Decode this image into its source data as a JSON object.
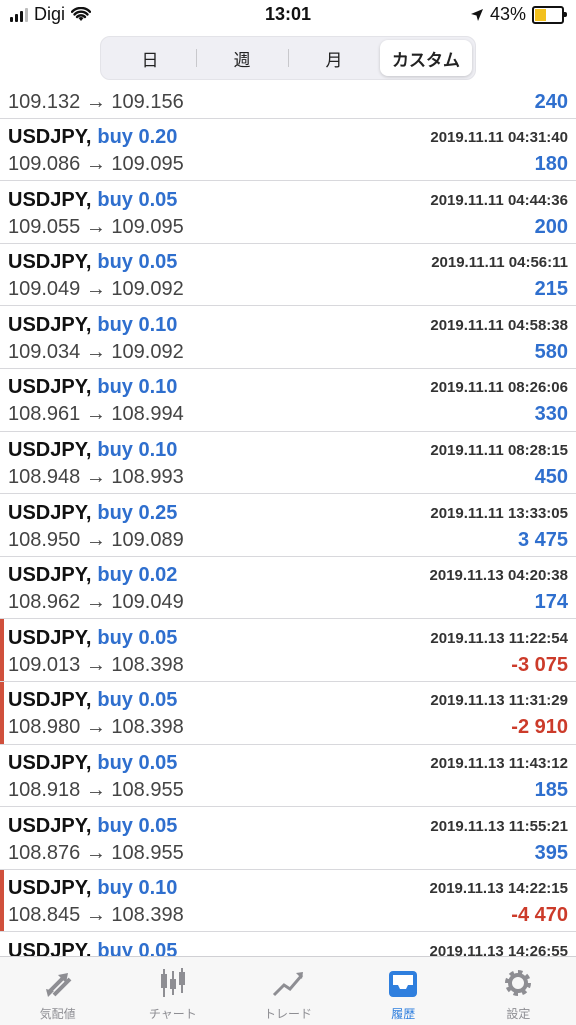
{
  "status_bar": {
    "carrier": "Digi",
    "time": "13:01",
    "battery": "43%",
    "battery_level": 0.43
  },
  "segments": [
    {
      "label": "日",
      "active": false
    },
    {
      "label": "週",
      "active": false
    },
    {
      "label": "月",
      "active": false
    },
    {
      "label": "カスタム",
      "active": true
    }
  ],
  "trades": [
    {
      "symbol": "",
      "side": "",
      "time": "",
      "prices": "109.132 → 109.156",
      "profit": "240",
      "loss": false
    },
    {
      "symbol": "USDJPY,",
      "side": "buy 0.20",
      "time": "2019.11.11 04:31:40",
      "prices": "109.086 → 109.095",
      "profit": "180",
      "loss": false
    },
    {
      "symbol": "USDJPY,",
      "side": "buy 0.05",
      "time": "2019.11.11 04:44:36",
      "prices": "109.055 → 109.095",
      "profit": "200",
      "loss": false
    },
    {
      "symbol": "USDJPY,",
      "side": "buy 0.05",
      "time": "2019.11.11 04:56:11",
      "prices": "109.049 → 109.092",
      "profit": "215",
      "loss": false
    },
    {
      "symbol": "USDJPY,",
      "side": "buy 0.10",
      "time": "2019.11.11 04:58:38",
      "prices": "109.034 → 109.092",
      "profit": "580",
      "loss": false
    },
    {
      "symbol": "USDJPY,",
      "side": "buy 0.10",
      "time": "2019.11.11 08:26:06",
      "prices": "108.961 → 108.994",
      "profit": "330",
      "loss": false
    },
    {
      "symbol": "USDJPY,",
      "side": "buy 0.10",
      "time": "2019.11.11 08:28:15",
      "prices": "108.948 → 108.993",
      "profit": "450",
      "loss": false
    },
    {
      "symbol": "USDJPY,",
      "side": "buy 0.25",
      "time": "2019.11.11 13:33:05",
      "prices": "108.950 → 109.089",
      "profit": "3 475",
      "loss": false
    },
    {
      "symbol": "USDJPY,",
      "side": "buy 0.02",
      "time": "2019.11.13 04:20:38",
      "prices": "108.962 → 109.049",
      "profit": "174",
      "loss": false
    },
    {
      "symbol": "USDJPY,",
      "side": "buy 0.05",
      "time": "2019.11.13 11:22:54",
      "prices": "109.013 → 108.398",
      "profit": "-3 075",
      "loss": true
    },
    {
      "symbol": "USDJPY,",
      "side": "buy 0.05",
      "time": "2019.11.13 11:31:29",
      "prices": "108.980 → 108.398",
      "profit": "-2 910",
      "loss": true
    },
    {
      "symbol": "USDJPY,",
      "side": "buy 0.05",
      "time": "2019.11.13 11:43:12",
      "prices": "108.918 → 108.955",
      "profit": "185",
      "loss": false
    },
    {
      "symbol": "USDJPY,",
      "side": "buy 0.05",
      "time": "2019.11.13 11:55:21",
      "prices": "108.876 → 108.955",
      "profit": "395",
      "loss": false
    },
    {
      "symbol": "USDJPY,",
      "side": "buy 0.10",
      "time": "2019.11.13 14:22:15",
      "prices": "108.845 → 108.398",
      "profit": "-4 470",
      "loss": true
    },
    {
      "symbol": "USDJPY,",
      "side": "buy 0.05",
      "time": "2019.11.13 14:26:55",
      "prices": "",
      "profit": "",
      "loss": false
    }
  ],
  "tabbar": [
    {
      "label": "気配値",
      "icon": "quotes-arrows-icon",
      "active": false
    },
    {
      "label": "チャート",
      "icon": "candlestick-chart-icon",
      "active": false
    },
    {
      "label": "トレード",
      "icon": "trade-trend-icon",
      "active": false
    },
    {
      "label": "履歴",
      "icon": "history-inbox-icon",
      "active": true
    },
    {
      "label": "設定",
      "icon": "settings-gear-icon",
      "active": false
    }
  ],
  "colors": {
    "accent": "#2f7fde",
    "profit": "#2f6fce",
    "loss": "#cc3b2a",
    "loss_marker": "#d0503c"
  }
}
